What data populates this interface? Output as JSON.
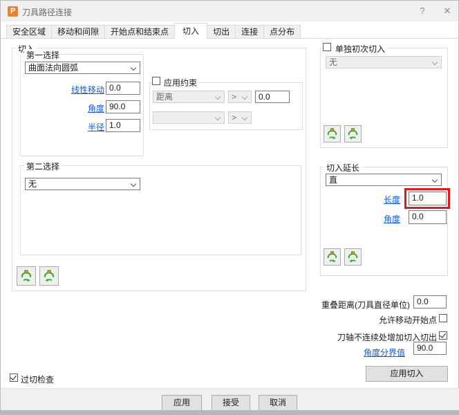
{
  "window": {
    "title": "刀具路径连接",
    "help_glyph": "?",
    "close_glyph": "✕",
    "app_icon_letter": "P"
  },
  "tabs": [
    {
      "label": "安全区域",
      "active": false
    },
    {
      "label": "移动和间隙",
      "active": false
    },
    {
      "label": "开始点和结束点",
      "active": false
    },
    {
      "label": "切入",
      "active": true
    },
    {
      "label": "切出",
      "active": false
    },
    {
      "label": "连接",
      "active": false
    },
    {
      "label": "点分布",
      "active": false
    }
  ],
  "lead_in": {
    "group_label": "切入",
    "first_choice": {
      "label": "第一选择",
      "selected": "曲面法向圆弧",
      "fields": [
        {
          "label": "线性移动",
          "value": "0.0"
        },
        {
          "label": "角度",
          "value": "90.0"
        },
        {
          "label": "半径",
          "value": "1.0"
        }
      ]
    },
    "constraints": {
      "label": "应用约束",
      "checked": false,
      "row1": {
        "type": "距离",
        "operator": ">",
        "value": "0.0"
      },
      "row2": {
        "type": "",
        "operator": ">"
      }
    },
    "second_choice": {
      "label": "第二选择",
      "selected": "无"
    }
  },
  "separate_first_lead": {
    "label": "单独初次切入",
    "checked": false,
    "selected": "无"
  },
  "extension": {
    "label": "切入延长",
    "selected": "直",
    "length_label": "长度",
    "length_value": "1.0",
    "angle_label": "角度",
    "angle_value": "0.0"
  },
  "options": {
    "overlap_label": "重叠距离(刀具直径单位)",
    "overlap_value": "0.0",
    "allow_move_label": "允许移动开始点",
    "allow_move_checked": false,
    "add_leads_label": "刀轴不连续处增加切入切出",
    "add_leads_checked": true,
    "threshold_label": "角度分界值",
    "threshold_value": "90.0",
    "apply_lead_in_label": "应用切入"
  },
  "gouge_check": {
    "label": "过切检查",
    "checked": true
  },
  "footer": {
    "apply": "应用",
    "accept": "接受",
    "cancel": "取消"
  },
  "icons": {
    "copy_buttons": [
      "copy-lead-forward-icon",
      "copy-lead-reverse-icon"
    ]
  },
  "colors": {
    "highlight_red": "#dd1b1b",
    "link_blue": "#155bcb",
    "app_icon_orange": "#ef8122",
    "icon_green": "#2eae2e",
    "icon_gold": "#d8b71c"
  }
}
